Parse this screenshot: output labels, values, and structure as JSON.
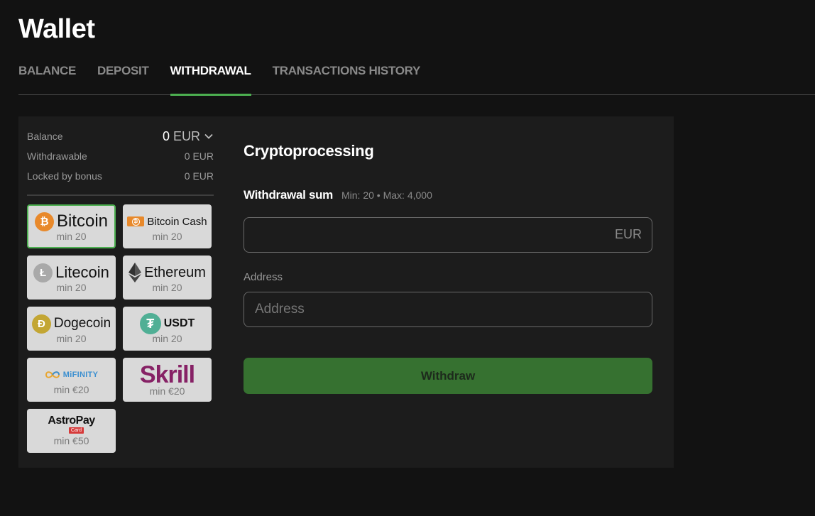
{
  "page": {
    "title": "Wallet"
  },
  "tabs": [
    {
      "label": "BALANCE",
      "active": false
    },
    {
      "label": "DEPOSIT",
      "active": false
    },
    {
      "label": "WITHDRAWAL",
      "active": true
    },
    {
      "label": "TRANSACTIONS HISTORY",
      "active": false
    }
  ],
  "balance": {
    "label": "Balance",
    "amount": "0",
    "currency": "EUR",
    "withdrawable_label": "Withdrawable",
    "withdrawable_value": "0 EUR",
    "locked_label": "Locked by bonus",
    "locked_value": "0 EUR"
  },
  "methods": [
    {
      "name": "Bitcoin",
      "min": "min 20",
      "icon": "bitcoin-icon",
      "selected": true
    },
    {
      "name": "Bitcoin Cash",
      "min": "min 20",
      "icon": "bitcoin-cash-icon",
      "selected": false
    },
    {
      "name": "Litecoin",
      "min": "min 20",
      "icon": "litecoin-icon",
      "selected": false
    },
    {
      "name": "Ethereum",
      "min": "min 20",
      "icon": "ethereum-icon",
      "selected": false
    },
    {
      "name": "Dogecoin",
      "min": "min 20",
      "icon": "dogecoin-icon",
      "selected": false
    },
    {
      "name": "USDT",
      "min": "min 20",
      "icon": "tether-icon",
      "selected": false
    },
    {
      "name": "MiFINITY",
      "min": "min €20",
      "icon": "mifinity-logo",
      "selected": false
    },
    {
      "name": "Skrill",
      "min": "min €20",
      "icon": "skrill-logo",
      "selected": false
    },
    {
      "name": "AstroPay",
      "badge": "Card",
      "min": "min €50",
      "icon": "astropay-logo",
      "selected": false
    }
  ],
  "form": {
    "title": "Cryptoprocessing",
    "sum_label": "Withdrawal sum",
    "sum_limits": "Min: 20 • Max: 4,000",
    "amount_value": "",
    "amount_currency": "EUR",
    "address_label": "Address",
    "address_placeholder": "Address",
    "address_value": "",
    "submit_label": "Withdraw"
  },
  "colors": {
    "accent": "#4caf50",
    "button": "#367130",
    "bitcoin": "#e8892b",
    "litecoin": "#a9a9a9",
    "dogecoin": "#c3a634",
    "tether": "#50af95",
    "skrill": "#862165",
    "mifinity": "#3b8fd0",
    "astropay_badge": "#d63a3a"
  }
}
